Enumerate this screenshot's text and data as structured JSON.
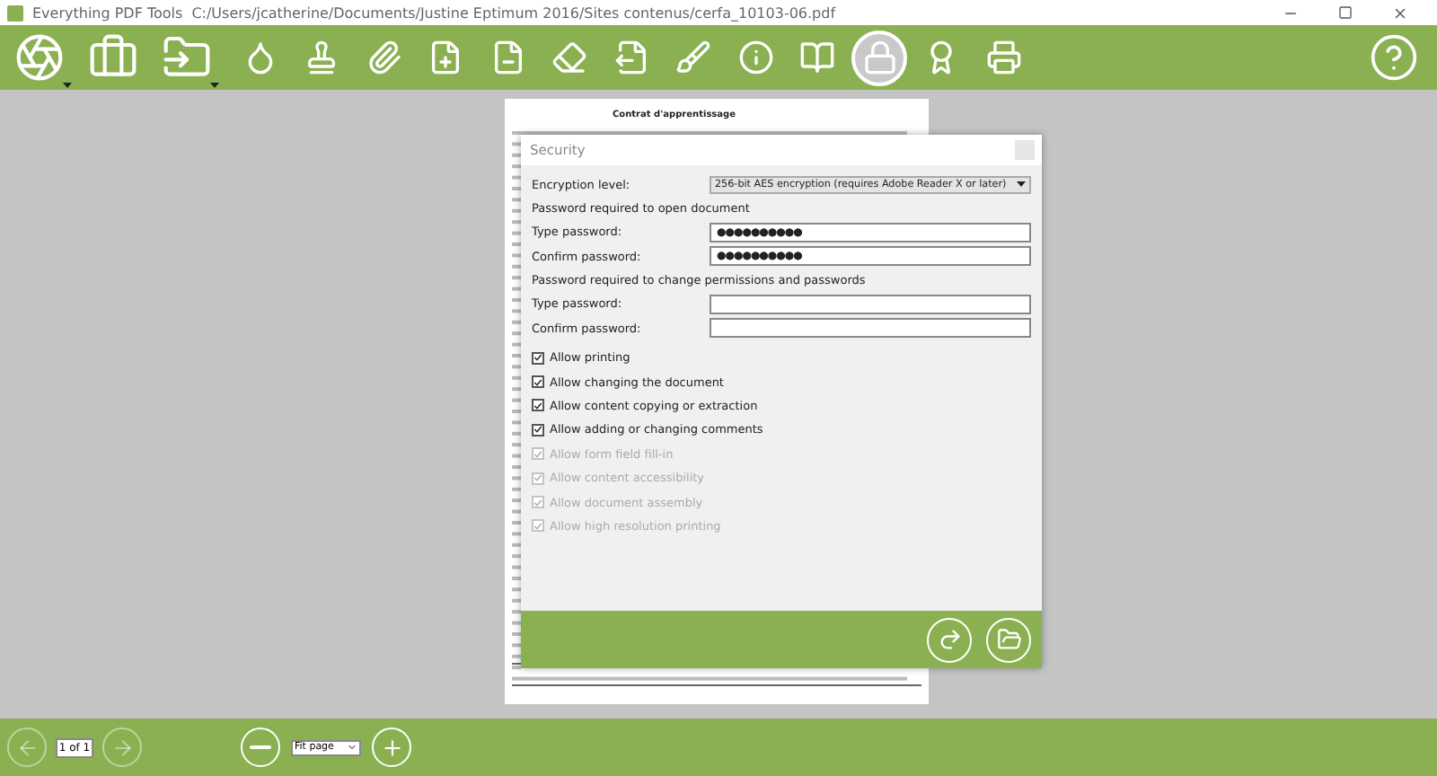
{
  "window": {
    "title": "Everything PDF Tools",
    "path": "C:/Users/jcatherine/Documents/Justine Eptimum 2016/Sites contenus/cerfa_10103-06.pdf"
  },
  "toolbar": {
    "tools": [
      {
        "selected": false,
        "menu": true
      },
      {
        "selected": false,
        "menu": false
      },
      {
        "selected": false,
        "menu": true
      },
      {
        "selected": false,
        "menu": false
      },
      {
        "selected": false,
        "menu": false
      },
      {
        "selected": false,
        "menu": false
      },
      {
        "selected": false,
        "menu": false
      },
      {
        "selected": false,
        "menu": false
      },
      {
        "selected": false,
        "menu": false
      },
      {
        "selected": false,
        "menu": false
      },
      {
        "selected": false,
        "menu": false
      },
      {
        "selected": false,
        "menu": false
      },
      {
        "selected": false,
        "menu": false
      },
      {
        "selected": true,
        "menu": false
      },
      {
        "selected": false,
        "menu": false
      },
      {
        "selected": false,
        "menu": false
      }
    ]
  },
  "document": {
    "heading": "Contrat d'apprentissage"
  },
  "dialog": {
    "title": "Security",
    "encryption": {
      "label": "Encryption level:",
      "value": "256-bit AES encryption (requires Adobe Reader X or later)"
    },
    "sections": [
      {
        "heading": "Password required to open document",
        "fields": [
          {
            "label": "Type password:",
            "value": "●●●●●●●●●●"
          },
          {
            "label": "Confirm password:",
            "value": "●●●●●●●●●●"
          }
        ]
      },
      {
        "heading": "Password required to change permissions and passwords",
        "fields": [
          {
            "label": "Type password:"
          },
          {
            "label": "Confirm password:"
          }
        ]
      }
    ],
    "permissions": [
      {
        "label": "Allow printing",
        "checked": true,
        "disabled": false
      },
      {
        "label": "Allow changing the document",
        "checked": true,
        "disabled": false
      },
      {
        "label": "Allow content copying or extraction",
        "checked": true,
        "disabled": false
      },
      {
        "label": "Allow adding or changing comments",
        "checked": true,
        "disabled": false
      },
      {
        "label": "Allow form field fill-in",
        "checked": true,
        "disabled": true
      },
      {
        "label": "Allow content accessibility",
        "checked": true,
        "disabled": true
      },
      {
        "label": "Allow document assembly",
        "checked": true,
        "disabled": true
      },
      {
        "label": "Allow high resolution printing",
        "checked": true,
        "disabled": true
      }
    ]
  },
  "bottom_bar": {
    "prev_disabled": true,
    "next_disabled": true,
    "page": "1 of 1",
    "zoom": "Fit page"
  }
}
